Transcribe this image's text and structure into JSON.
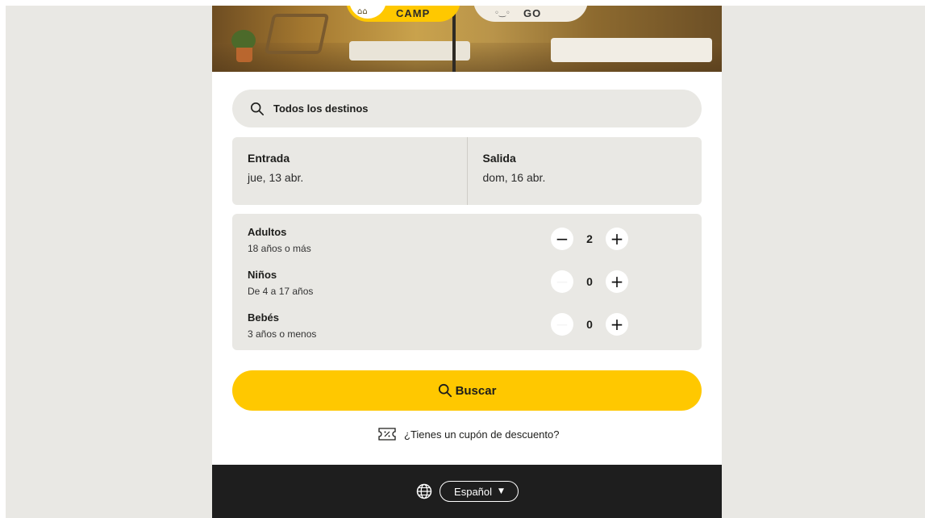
{
  "hero": {
    "chips": [
      {
        "label": "CAMP",
        "icon": "tent-icon"
      },
      {
        "label": "GO",
        "icon": "van-icon"
      }
    ]
  },
  "search": {
    "text": "Todos los destinos",
    "icon": "search-icon"
  },
  "dates": {
    "checkin": {
      "label": "Entrada",
      "value": "jue, 13 abr."
    },
    "checkout": {
      "label": "Salida",
      "value": "dom, 16 abr."
    }
  },
  "guests": [
    {
      "label": "Adultos",
      "sub": "18 años o más",
      "count": "2",
      "minus_enabled": true
    },
    {
      "label": "Niños",
      "sub": "De 4 a 17 años",
      "count": "0",
      "minus_enabled": false
    },
    {
      "label": "Bebés",
      "sub": "3 años o menos",
      "count": "0",
      "minus_enabled": false
    }
  ],
  "stepper": {
    "minus": "−",
    "plus": "+"
  },
  "buscar": {
    "label": "Buscar",
    "icon": "search-icon"
  },
  "coupon": {
    "text": "¿Tienes un cupón de descuento?",
    "icon": "coupon-icon"
  },
  "footer": {
    "language": "Español",
    "caret": "▼",
    "icon": "globe-icon"
  },
  "colors": {
    "accent": "#ffc800",
    "footer_bg": "#1e1e1e",
    "field_bg": "#e9e8e4"
  }
}
